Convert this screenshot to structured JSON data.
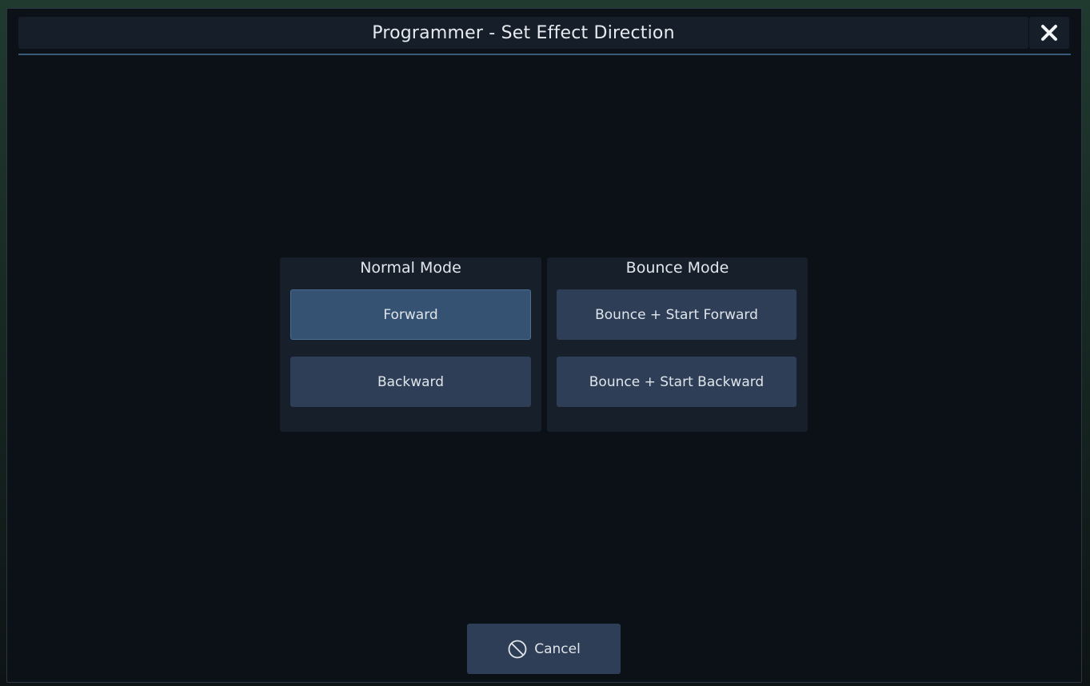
{
  "dialog": {
    "title": "Programmer - Set Effect Direction",
    "close_icon": "close-icon"
  },
  "normal_mode": {
    "title": "Normal Mode",
    "buttons": [
      {
        "label": "Forward",
        "selected": true
      },
      {
        "label": "Backward",
        "selected": false
      }
    ]
  },
  "bounce_mode": {
    "title": "Bounce Mode",
    "buttons": [
      {
        "label": "Bounce + Start Forward",
        "selected": false
      },
      {
        "label": "Bounce + Start Backward",
        "selected": false
      }
    ]
  },
  "footer": {
    "cancel_label": "Cancel",
    "cancel_icon": "prohibited-icon"
  },
  "colors": {
    "dialog_bg": "#0c1118",
    "button_bg": "#2f3e57",
    "button_selected_bg": "#365272",
    "accent_line": "#3a5a7a",
    "text": "#dfe4ea"
  }
}
